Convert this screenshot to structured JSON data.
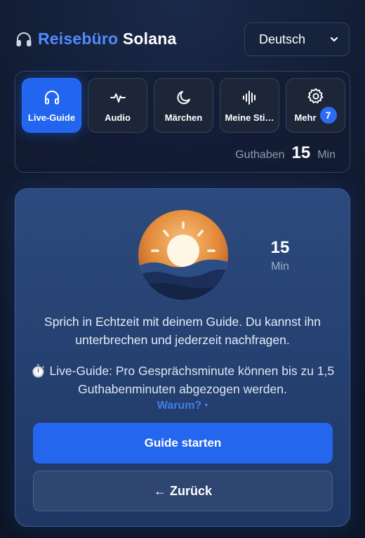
{
  "header": {
    "brand_part1": "Reisebüro",
    "brand_part2": "Solana",
    "language": "Deutsch",
    "accent": "#4f8cff"
  },
  "modes": {
    "tabs": [
      {
        "label": "Live-Guide",
        "icon": "headphones-icon",
        "active": true
      },
      {
        "label": "Audio",
        "icon": "waveform-icon",
        "active": false
      },
      {
        "label": "Märchen",
        "icon": "moon-icon",
        "active": false
      },
      {
        "label": "Meine Sti…",
        "icon": "voice-bars-icon",
        "active": false
      },
      {
        "label": "Mehr",
        "icon": "gear-icon",
        "active": false,
        "badge": "7"
      }
    ],
    "credit_label": "Guthaben",
    "credit_value": "15",
    "credit_unit": "Min"
  },
  "card": {
    "timer_value": "15",
    "timer_unit": "Min",
    "description": "Sprich in Echtzeit mit deinem Guide. Du kannst ihn unterbrechen und jederzeit nachfragen.",
    "note_icon": "⏱️",
    "note": "Live-Guide: Pro Gesprächsminute können bis zu 1,5 Guthabenminuten abgezogen werden.",
    "why_label": "Warum?",
    "why_caret": "▾",
    "start_label": "Guide starten",
    "back_label": "← Zurück",
    "primary_color": "#2466ee"
  }
}
